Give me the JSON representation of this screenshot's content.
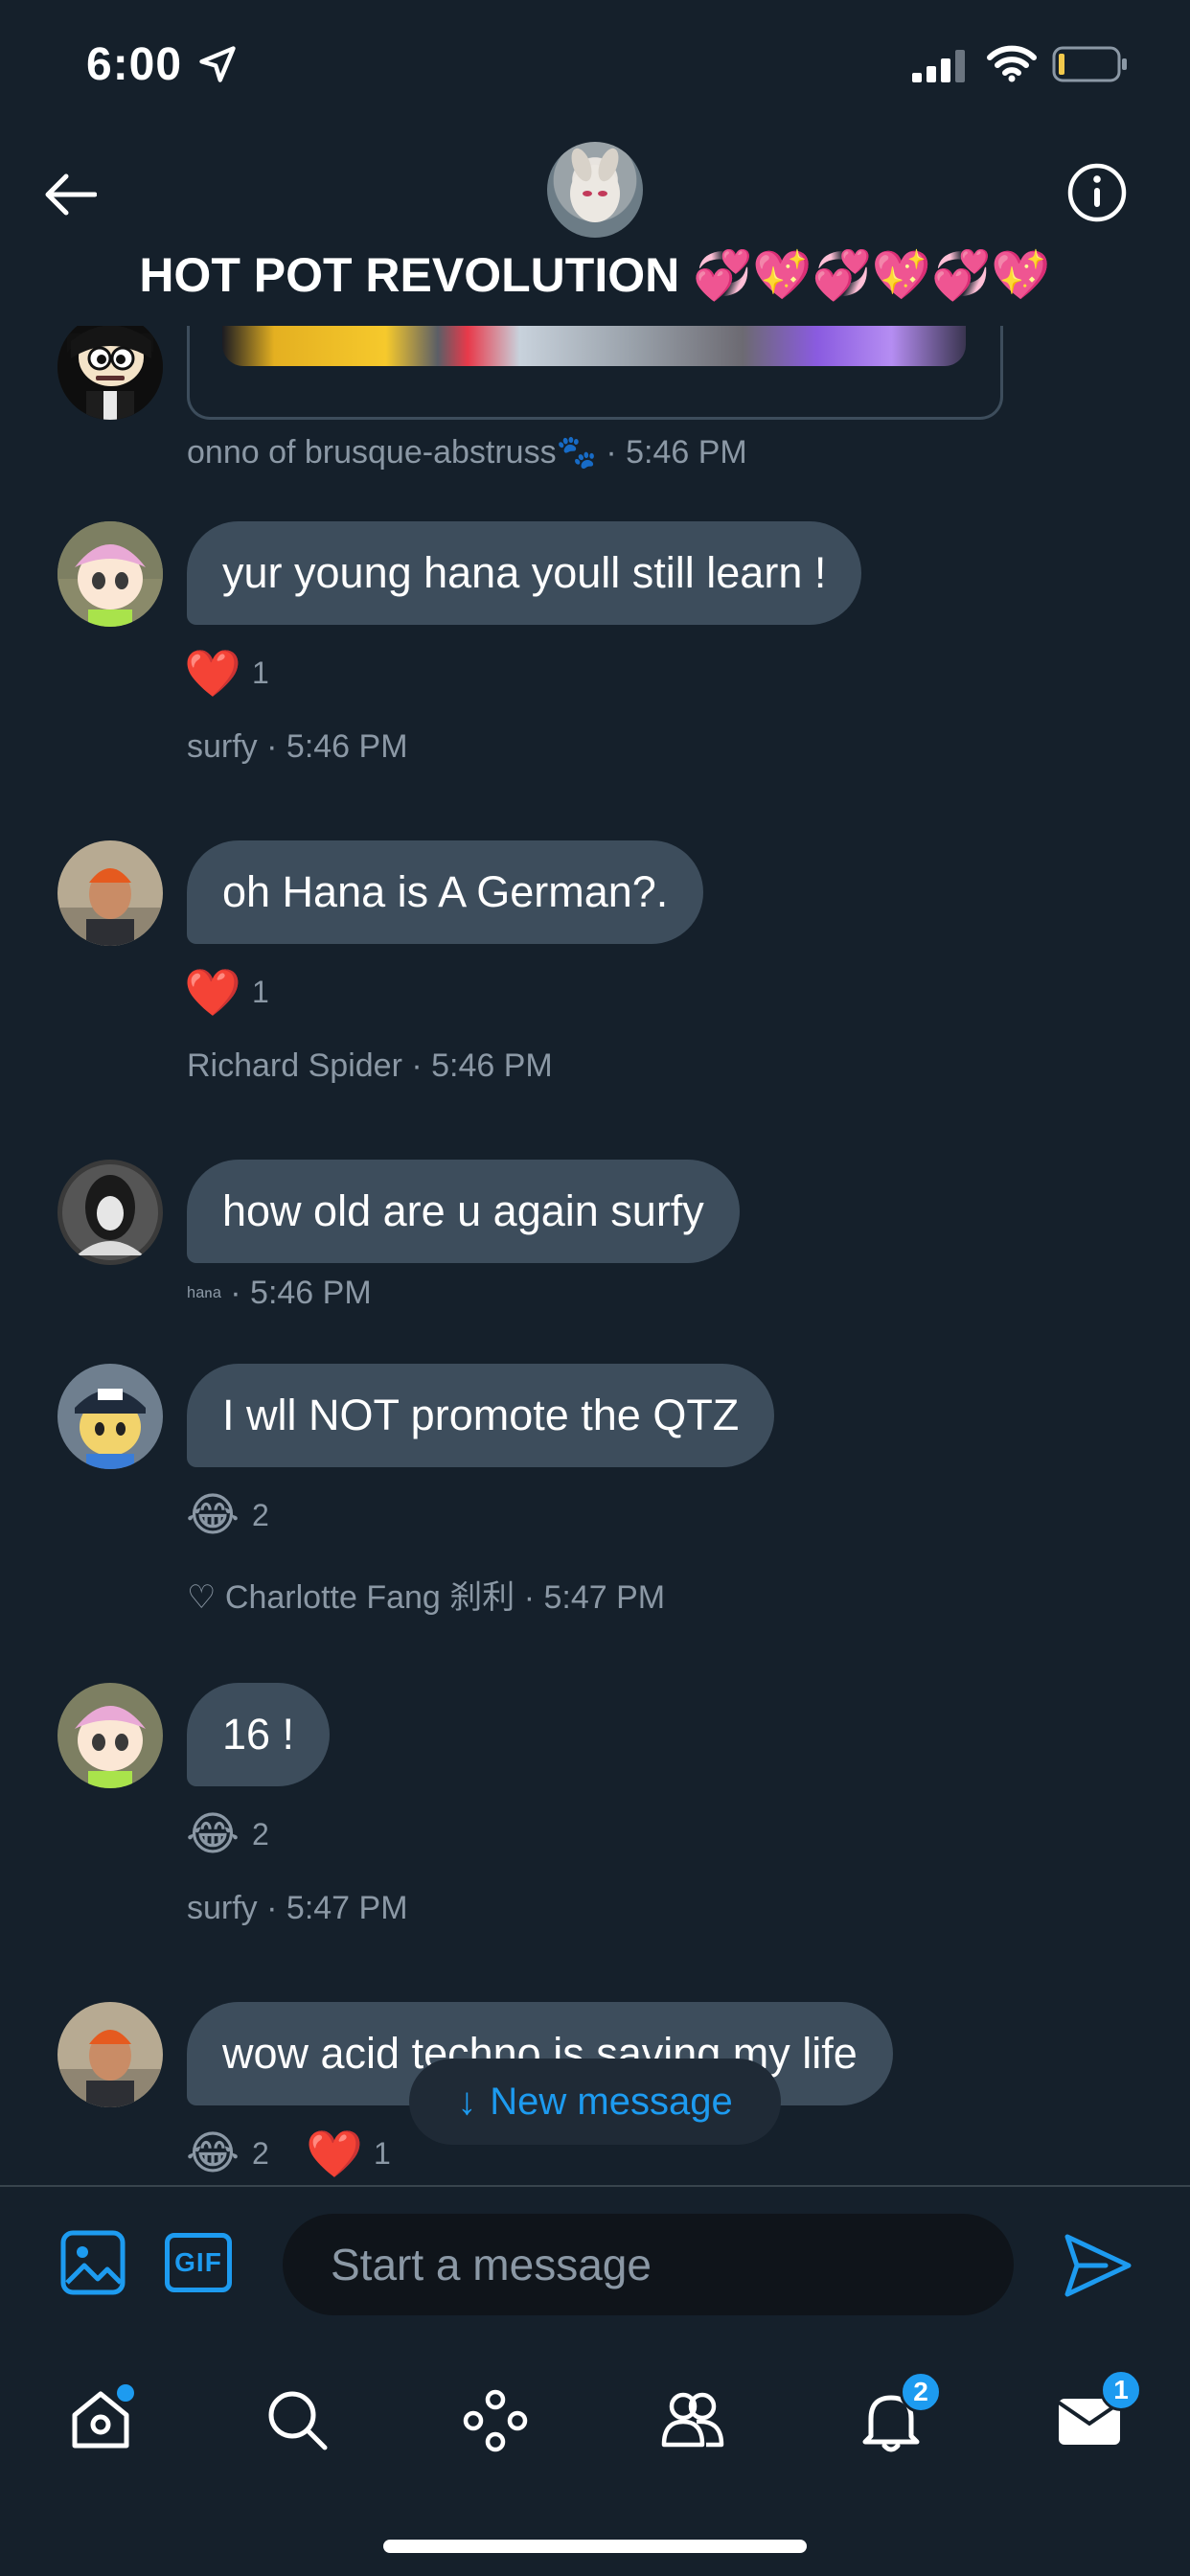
{
  "status_bar": {
    "time": "6:00"
  },
  "header": {
    "title": "HOT POT REVOLUTION 💞💖💞💖💞💖"
  },
  "messages": [
    {
      "text": "",
      "sender": "onno of brusque-abstruss🐾",
      "time": "5:46 PM",
      "reactions": []
    },
    {
      "text": "yur young hana youll still learn !",
      "sender": "surfy",
      "time": "5:46 PM",
      "reactions": [
        {
          "emoji": "❤️",
          "count": "1"
        }
      ]
    },
    {
      "text": "oh Hana is A German?.",
      "sender": "Richard Spider",
      "time": "5:46 PM",
      "reactions": [
        {
          "emoji": "❤️",
          "count": "1"
        }
      ]
    },
    {
      "text": "how old are u again surfy",
      "sender": "ʰᵃⁿᵃ",
      "time": "5:46 PM",
      "reactions": []
    },
    {
      "text": "I wll NOT promote the QTZ",
      "sender": "♡ Charlotte Fang 刹利",
      "time": "5:47 PM",
      "reactions": [
        {
          "emoji": "😂",
          "count": "2"
        }
      ]
    },
    {
      "text": "16 !",
      "sender": "surfy",
      "time": "5:47 PM",
      "reactions": [
        {
          "emoji": "😂",
          "count": "2"
        }
      ]
    },
    {
      "text": "wow acid techno is saving my life",
      "sender": "",
      "time": "",
      "reactions": [
        {
          "emoji": "😂",
          "count": "2"
        },
        {
          "emoji": "❤️",
          "count": "1"
        }
      ]
    }
  ],
  "meta_separator": " · ",
  "new_message": {
    "label": "New message",
    "arrow": "↓"
  },
  "composer": {
    "placeholder": "Start a message",
    "gif_label": "GIF"
  },
  "tab_bar": {
    "items": [
      {
        "name": "home",
        "icon": "home-icon",
        "has_dot": true
      },
      {
        "name": "search",
        "icon": "search-icon"
      },
      {
        "name": "spaces",
        "icon": "spaces-icon"
      },
      {
        "name": "communities",
        "icon": "communities-icon"
      },
      {
        "name": "notifications",
        "icon": "bell-icon",
        "badge": "2"
      },
      {
        "name": "messages",
        "icon": "mail-icon",
        "badge": "1"
      }
    ]
  },
  "colors": {
    "background": "#15202b",
    "bubble": "#3d4d5c",
    "accent": "#1d9bf0",
    "meta_text": "#8b98a5"
  }
}
